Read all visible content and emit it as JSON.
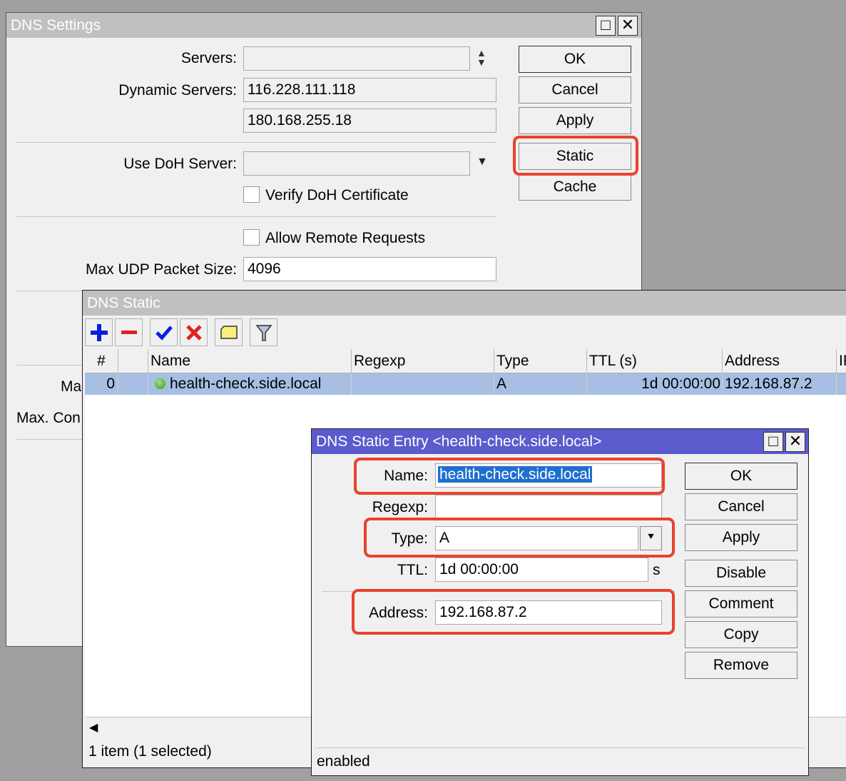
{
  "dns_settings": {
    "title": "DNS Settings",
    "servers_label": "Servers:",
    "servers_value": "",
    "dynamic_servers_label": "Dynamic Servers:",
    "dynamic_servers": [
      "116.228.111.118",
      "180.168.255.18"
    ],
    "use_doh_label": "Use DoH Server:",
    "use_doh_value": "",
    "verify_doh_label": "Verify DoH Certificate",
    "verify_doh_checked": false,
    "allow_remote_label": "Allow Remote Requests",
    "allow_remote_checked": false,
    "max_udp_label": "Max UDP Packet Size:",
    "max_udp_value": "4096",
    "partial_label_1": "Ma",
    "partial_label_2": "Max. Con",
    "buttons": {
      "ok": "OK",
      "cancel": "Cancel",
      "apply": "Apply",
      "static": "Static",
      "cache": "Cache"
    }
  },
  "dns_static": {
    "title": "DNS Static",
    "toolbar": [
      "add-icon",
      "remove-icon",
      "enable-icon",
      "disable-icon",
      "comment-icon",
      "filter-icon"
    ],
    "columns": [
      "#",
      "",
      "Name",
      "Regexp",
      "Type",
      "TTL (s)",
      "Address",
      "IP"
    ],
    "rows": [
      {
        "num": "0",
        "status": "enabled",
        "name": "health-check.side.local",
        "regexp": "",
        "type": "A",
        "ttl": "1d 00:00:00",
        "address": "192.168.87.2"
      }
    ],
    "status": "1 item (1 selected)"
  },
  "dns_entry": {
    "title": "DNS Static Entry <health-check.side.local>",
    "name_label": "Name:",
    "name_value": "health-check.side.local",
    "regexp_label": "Regexp:",
    "regexp_value": "",
    "type_label": "Type:",
    "type_value": "A",
    "ttl_label": "TTL:",
    "ttl_value": "1d 00:00:00",
    "ttl_unit": "s",
    "address_label": "Address:",
    "address_value": "192.168.87.2",
    "buttons": {
      "ok": "OK",
      "cancel": "Cancel",
      "apply": "Apply",
      "disable": "Disable",
      "comment": "Comment",
      "copy": "Copy",
      "remove": "Remove"
    },
    "status": "enabled"
  },
  "colors": {
    "highlight": "#e8432c",
    "selection": "#a6bfe3",
    "active_title": "#5b5bce"
  }
}
